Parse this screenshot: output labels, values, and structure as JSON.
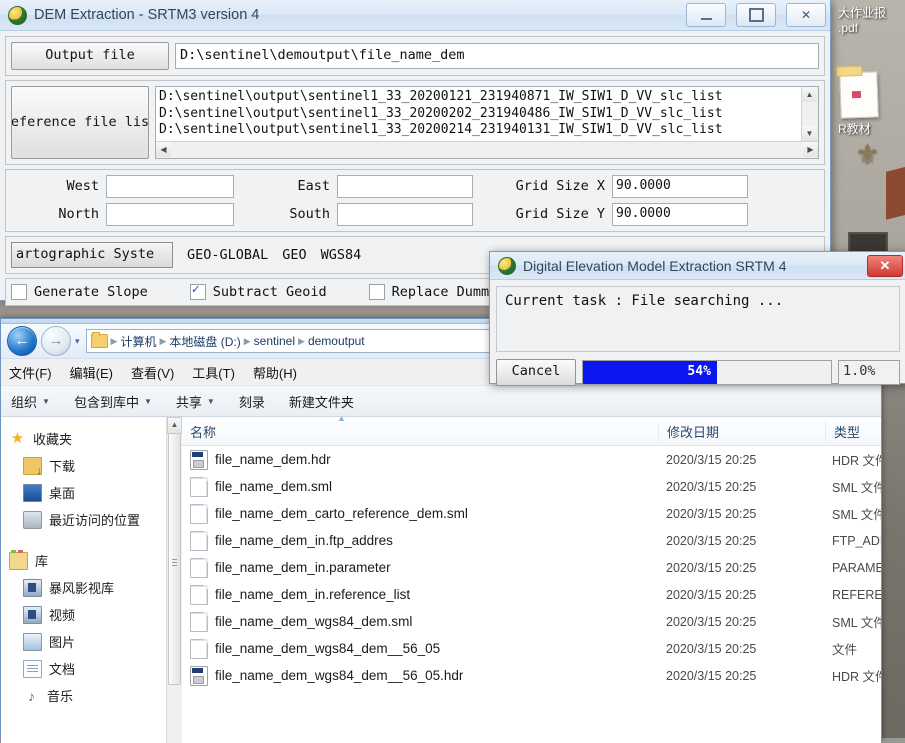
{
  "desktop": {
    "icon_labels": [
      "大作业报\n.pdf",
      "R教材"
    ],
    "label1_line1": "大作业报",
    "label1_line2": ".pdf",
    "label2": "R教材"
  },
  "dem_window": {
    "title": "DEM Extraction - SRTM3 version 4",
    "icon": "globe-icon",
    "minimize_label": "minimize",
    "maximize_label": "maximize",
    "close_label": "✕",
    "output_file": {
      "button_label": "Output file",
      "value": "D:\\sentinel\\demoutput\\file_name_dem"
    },
    "reference_file_list": {
      "button_label": "eference file lis",
      "lines": [
        "D:\\sentinel\\output\\sentinel1_33_20200121_231940871_IW_SIW1_D_VV_slc_list",
        "D:\\sentinel\\output\\sentinel1_33_20200202_231940486_IW_SIW1_D_VV_slc_list",
        "D:\\sentinel\\output\\sentinel1_33_20200214_231940131_IW_SIW1_D_VV_slc_list"
      ],
      "scroll_up": "▲",
      "scroll_down": "▼",
      "scroll_left": "◀",
      "scroll_right": "▶"
    },
    "coords": {
      "west_label": "West",
      "west_value": "",
      "north_label": "North",
      "north_value": "",
      "east_label": "East",
      "east_value": "",
      "south_label": "South",
      "south_value": "",
      "grid_x_label": "Grid Size X",
      "grid_x_value": "90.0000",
      "grid_y_label": "Grid Size Y",
      "grid_y_value": "90.0000"
    },
    "cartographic": {
      "button_label": "artographic Syste",
      "system": "GEO-GLOBAL",
      "projection": "GEO",
      "datum": "WGS84"
    },
    "options": [
      {
        "label": "Generate Slope",
        "checked": false
      },
      {
        "label": "Subtract Geoid",
        "checked": true
      },
      {
        "label": "Replace Dummy Wit",
        "checked": false
      }
    ]
  },
  "progress_dialog": {
    "title": "Digital Elevation Model Extraction SRTM 4",
    "icon": "globe-icon",
    "close_label": "✕",
    "message": "Current task : File searching ...",
    "cancel_label": "Cancel",
    "bar_percent": 54,
    "bar_label": "54%",
    "secondary_percent": "1.0%",
    "bar_color": "#0b16f0"
  },
  "explorer": {
    "nav": {
      "back_glyph": "←",
      "forward_glyph": "→",
      "dropdown_glyph": "▾"
    },
    "breadcrumbs": [
      {
        "label": "计算机",
        "grey": false
      },
      {
        "label": "本地磁盘 (D:)",
        "grey": false
      },
      {
        "label": "sentinel",
        "grey": false
      },
      {
        "label": "demoutput",
        "grey": false
      }
    ],
    "menus": [
      "文件(F)",
      "编辑(E)",
      "查看(V)",
      "工具(T)",
      "帮助(H)"
    ],
    "toolbar": [
      {
        "label": "组织",
        "caret": true
      },
      {
        "label": "包含到库中",
        "caret": true
      },
      {
        "label": "共享",
        "caret": true
      },
      {
        "label": "刻录",
        "caret": false
      },
      {
        "label": "新建文件夹",
        "caret": false
      }
    ],
    "sidebar": [
      {
        "label": "收藏夹",
        "icon": "star-icon",
        "child": false
      },
      {
        "label": "下载",
        "icon": "download-folder-icon",
        "child": true
      },
      {
        "label": "桌面",
        "icon": "desktop-icon",
        "child": true
      },
      {
        "label": "最近访问的位置",
        "icon": "recent-places-icon",
        "child": true
      },
      {
        "label": "",
        "icon": "spacer",
        "child": false
      },
      {
        "label": "库",
        "icon": "library-icon",
        "child": false
      },
      {
        "label": "暴风影视库",
        "icon": "media-library-icon",
        "child": true
      },
      {
        "label": "视频",
        "icon": "video-icon",
        "child": true
      },
      {
        "label": "图片",
        "icon": "pictures-icon",
        "child": true
      },
      {
        "label": "文档",
        "icon": "documents-icon",
        "child": true
      },
      {
        "label": "音乐",
        "icon": "music-icon",
        "child": true
      }
    ],
    "columns": [
      "名称",
      "修改日期",
      "类型"
    ],
    "files": [
      {
        "name": "file_name_dem.hdr",
        "date": "2020/3/15 20:25",
        "type": "HDR 文件",
        "icon": "hdr-file-icon"
      },
      {
        "name": "file_name_dem.sml",
        "date": "2020/3/15 20:25",
        "type": "SML 文件",
        "icon": "blank-file-icon"
      },
      {
        "name": "file_name_dem_carto_reference_dem.sml",
        "date": "2020/3/15 20:25",
        "type": "SML 文件",
        "icon": "blank-file-icon"
      },
      {
        "name": "file_name_dem_in.ftp_addres",
        "date": "2020/3/15 20:25",
        "type": "FTP_ADDRES",
        "icon": "blank-file-icon"
      },
      {
        "name": "file_name_dem_in.parameter",
        "date": "2020/3/15 20:25",
        "type": "PARAMETER",
        "icon": "blank-file-icon"
      },
      {
        "name": "file_name_dem_in.reference_list",
        "date": "2020/3/15 20:25",
        "type": "REFERENCE_L",
        "icon": "blank-file-icon"
      },
      {
        "name": "file_name_dem_wgs84_dem.sml",
        "date": "2020/3/15 20:25",
        "type": "SML 文件",
        "icon": "blank-file-icon"
      },
      {
        "name": "file_name_dem_wgs84_dem__56_05",
        "date": "2020/3/15 20:25",
        "type": "文件",
        "icon": "blank-file-icon"
      },
      {
        "name": "file_name_dem_wgs84_dem__56_05.hdr",
        "date": "2020/3/15 20:25",
        "type": "HDR 文件",
        "icon": "hdr-file-icon"
      }
    ]
  }
}
